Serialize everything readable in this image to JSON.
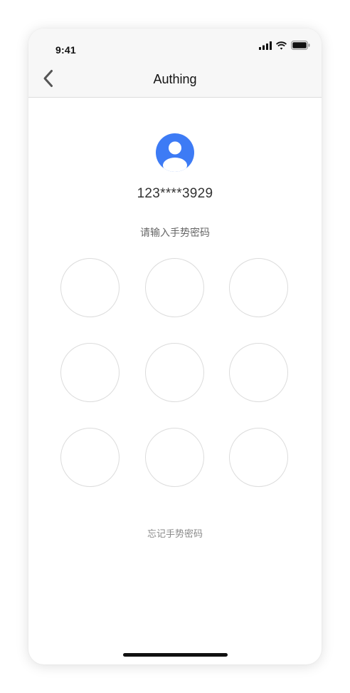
{
  "status_bar": {
    "time": "9:41",
    "icons": [
      "cellular-signal-icon",
      "wifi-icon",
      "battery-icon"
    ]
  },
  "nav": {
    "title": "Authing",
    "back_icon": "chevron-left-icon"
  },
  "profile": {
    "avatar_icon": "user-avatar-icon",
    "account": "123****3929"
  },
  "gesture": {
    "prompt": "请输入手势密码",
    "dots": [
      1,
      2,
      3,
      4,
      5,
      6,
      7,
      8,
      9
    ],
    "forgot_label": "忘记手势密码"
  },
  "colors": {
    "accent": "#3D7BF5",
    "dot_border": "#DCDCDC",
    "text_primary": "#111111",
    "text_secondary": "#666666"
  }
}
